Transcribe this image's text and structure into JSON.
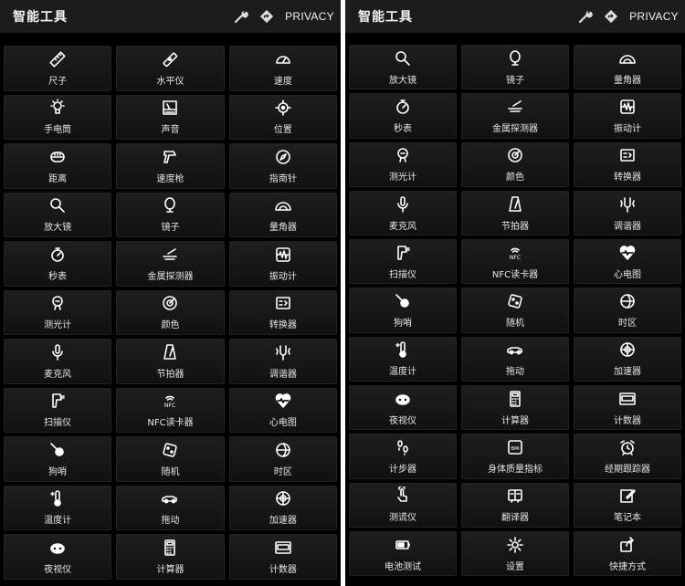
{
  "colors": {
    "background": "#000000",
    "topbar": "#1c1c1c",
    "tile": "#181818",
    "text": "#e6e6e6"
  },
  "screens": [
    {
      "title": "智能工具",
      "header_icons": [
        "wrench-icon",
        "direction-sign-icon"
      ],
      "privacy_label": "PRIVACY",
      "tools": [
        {
          "label": "尺子",
          "icon": "ruler-icon"
        },
        {
          "label": "水平仪",
          "icon": "level-icon"
        },
        {
          "label": "速度",
          "icon": "speedometer-icon"
        },
        {
          "label": "手电筒",
          "icon": "flashlight-icon"
        },
        {
          "label": "声音",
          "icon": "sound-meter-icon"
        },
        {
          "label": "位置",
          "icon": "location-icon"
        },
        {
          "label": "距离",
          "icon": "tape-measure-icon"
        },
        {
          "label": "速度枪",
          "icon": "speed-gun-icon"
        },
        {
          "label": "指南针",
          "icon": "compass-icon"
        },
        {
          "label": "放大镜",
          "icon": "magnifier-icon"
        },
        {
          "label": "镜子",
          "icon": "mirror-icon"
        },
        {
          "label": "量角器",
          "icon": "protractor-icon"
        },
        {
          "label": "秒表",
          "icon": "stopwatch-icon"
        },
        {
          "label": "金属探测器",
          "icon": "metal-detector-icon"
        },
        {
          "label": "振动计",
          "icon": "vibration-meter-icon"
        },
        {
          "label": "测光计",
          "icon": "light-meter-icon"
        },
        {
          "label": "颜色",
          "icon": "color-picker-icon"
        },
        {
          "label": "转换器",
          "icon": "converter-icon"
        },
        {
          "label": "麦克风",
          "icon": "microphone-icon"
        },
        {
          "label": "节拍器",
          "icon": "metronome-icon"
        },
        {
          "label": "调谐器",
          "icon": "tuner-icon"
        },
        {
          "label": "扫描仪",
          "icon": "scanner-icon"
        },
        {
          "label": "NFC读卡器",
          "icon": "nfc-icon"
        },
        {
          "label": "心电图",
          "icon": "heart-rate-icon"
        },
        {
          "label": "狗哨",
          "icon": "dog-whistle-icon"
        },
        {
          "label": "随机",
          "icon": "dice-icon"
        },
        {
          "label": "时区",
          "icon": "globe-clock-icon"
        },
        {
          "label": "温度计",
          "icon": "thermometer-icon"
        },
        {
          "label": "拖动",
          "icon": "car-icon"
        },
        {
          "label": "加速器",
          "icon": "accelerometer-icon"
        },
        {
          "label": "夜视仪",
          "icon": "night-vision-icon"
        },
        {
          "label": "计算器",
          "icon": "calculator-icon"
        },
        {
          "label": "计数器",
          "icon": "counter-icon"
        }
      ]
    },
    {
      "title": "智能工具",
      "header_icons": [
        "wrench-icon",
        "direction-sign-icon"
      ],
      "privacy_label": "PRIVACY",
      "tools": [
        {
          "label": "放大镜",
          "icon": "magnifier-icon"
        },
        {
          "label": "镜子",
          "icon": "mirror-icon"
        },
        {
          "label": "量角器",
          "icon": "protractor-icon"
        },
        {
          "label": "秒表",
          "icon": "stopwatch-icon"
        },
        {
          "label": "金属探测器",
          "icon": "metal-detector-icon"
        },
        {
          "label": "振动计",
          "icon": "vibration-meter-icon"
        },
        {
          "label": "测光计",
          "icon": "light-meter-icon"
        },
        {
          "label": "颜色",
          "icon": "color-picker-icon"
        },
        {
          "label": "转换器",
          "icon": "converter-icon"
        },
        {
          "label": "麦克风",
          "icon": "microphone-icon"
        },
        {
          "label": "节拍器",
          "icon": "metronome-icon"
        },
        {
          "label": "调谐器",
          "icon": "tuner-icon"
        },
        {
          "label": "扫描仪",
          "icon": "scanner-icon"
        },
        {
          "label": "NFC读卡器",
          "icon": "nfc-icon"
        },
        {
          "label": "心电图",
          "icon": "heart-rate-icon"
        },
        {
          "label": "狗哨",
          "icon": "dog-whistle-icon"
        },
        {
          "label": "随机",
          "icon": "dice-icon"
        },
        {
          "label": "时区",
          "icon": "globe-clock-icon"
        },
        {
          "label": "温度计",
          "icon": "thermometer-icon"
        },
        {
          "label": "拖动",
          "icon": "car-icon"
        },
        {
          "label": "加速器",
          "icon": "accelerometer-icon"
        },
        {
          "label": "夜视仪",
          "icon": "night-vision-icon"
        },
        {
          "label": "计算器",
          "icon": "calculator-icon"
        },
        {
          "label": "计数器",
          "icon": "counter-icon"
        },
        {
          "label": "计步器",
          "icon": "footsteps-icon"
        },
        {
          "label": "身体质量指标",
          "icon": "bmi-scale-icon"
        },
        {
          "label": "经期跟踪器",
          "icon": "alarm-clock-icon"
        },
        {
          "label": "测谎仪",
          "icon": "hand-touch-icon"
        },
        {
          "label": "翻译器",
          "icon": "translator-icon"
        },
        {
          "label": "笔记本",
          "icon": "note-edit-icon"
        },
        {
          "label": "电池测试",
          "icon": "battery-icon"
        },
        {
          "label": "设置",
          "icon": "gear-icon"
        },
        {
          "label": "快捷方式",
          "icon": "share-shortcut-icon"
        }
      ]
    }
  ]
}
